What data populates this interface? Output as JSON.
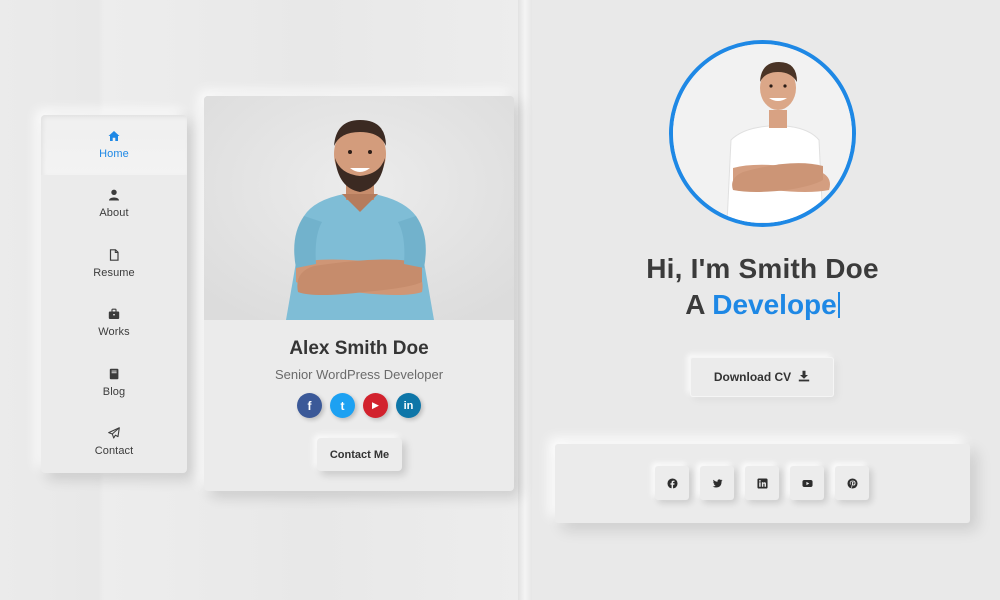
{
  "nav": {
    "items": [
      {
        "label": "Home",
        "icon": "home-icon",
        "active": true
      },
      {
        "label": "About",
        "icon": "user-icon",
        "active": false
      },
      {
        "label": "Resume",
        "icon": "file-icon",
        "active": false
      },
      {
        "label": "Works",
        "icon": "briefcase-icon",
        "active": false
      },
      {
        "label": "Blog",
        "icon": "book-icon",
        "active": false
      },
      {
        "label": "Contact",
        "icon": "paper-plane-icon",
        "active": false
      }
    ]
  },
  "card": {
    "name": "Alex Smith Doe",
    "role": "Senior WordPress Developer",
    "social": [
      {
        "icon": "facebook-icon",
        "glyph": "f",
        "color": "#3b5998"
      },
      {
        "icon": "twitter-icon",
        "glyph": "t",
        "color": "#1da1f2"
      },
      {
        "icon": "youtube-icon",
        "glyph": "▶",
        "color": "#d2222d"
      },
      {
        "icon": "linkedin-icon",
        "glyph": "in",
        "color": "#0e76a8"
      }
    ],
    "contact_label": "Contact Me"
  },
  "hero": {
    "greeting": "Hi, I'm Smith Doe",
    "prefix": "A",
    "typed_word": "Develope",
    "download_label": "Download CV"
  },
  "social_panel": {
    "items": [
      {
        "icon": "facebook-icon",
        "glyph": "f"
      },
      {
        "icon": "twitter-icon",
        "glyph": "t"
      },
      {
        "icon": "linkedin-icon",
        "glyph": "in"
      },
      {
        "icon": "youtube-icon",
        "glyph": "▶"
      },
      {
        "icon": "pinterest-icon",
        "glyph": "p"
      }
    ]
  },
  "colors": {
    "accent": "#1e88e5",
    "background": "#e9e9e9",
    "text": "#3b3b3b"
  }
}
